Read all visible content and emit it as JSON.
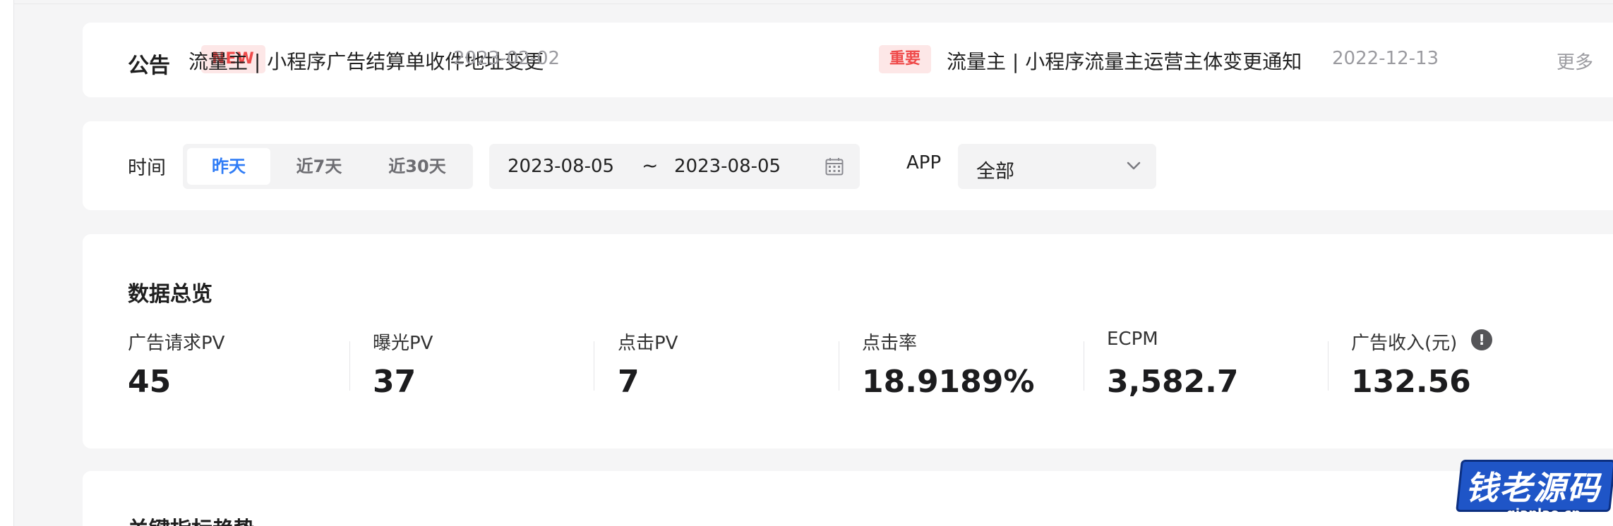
{
  "notice": {
    "title": "公告",
    "items": [
      {
        "tag": "NEW",
        "text": "流量主 | 小程序广告结算单收件地址变更",
        "date": "2023-02-02"
      },
      {
        "tag": "重要",
        "text": "流量主 | 小程序流量主运营主体变更通知",
        "date": "2022-12-13"
      }
    ],
    "more": "更多"
  },
  "filter": {
    "time_label": "时间",
    "ranges": [
      "昨天",
      "近7天",
      "近30天"
    ],
    "active_range": "昨天",
    "start_date": "2023-08-05",
    "separator": "~",
    "end_date": "2023-08-05",
    "app_label": "APP",
    "app_value": "全部"
  },
  "overview": {
    "title": "数据总览",
    "metrics": [
      {
        "label": "广告请求PV",
        "value": "45"
      },
      {
        "label": "曝光PV",
        "value": "37"
      },
      {
        "label": "点击PV",
        "value": "7"
      },
      {
        "label": "点击率",
        "value": "18.9189%"
      },
      {
        "label": "ECPM",
        "value": "3,582.7"
      },
      {
        "label": "广告收入(元)",
        "value": "132.56"
      }
    ],
    "info_icon": "!"
  },
  "trend": {
    "title": "关键指标趋势"
  },
  "watermark": {
    "text": "钱老源码",
    "sub": "qianlao.cn"
  },
  "colors": {
    "accent": "#2f7cf6",
    "tag_bg": "#fde7e7",
    "tag_text": "#ef4a4a",
    "background": "#f5f5f6"
  }
}
